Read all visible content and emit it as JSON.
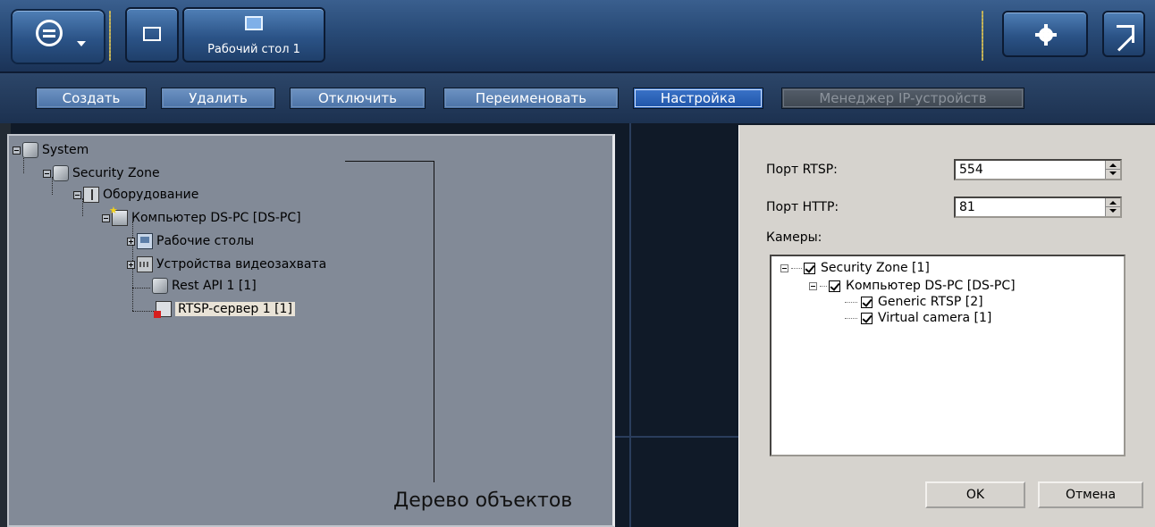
{
  "topbar": {
    "desktop_tab_label": "Рабочий стол 1"
  },
  "actions": {
    "create": "Создать",
    "delete": "Удалить",
    "disable": "Отключить",
    "rename": "Переименовать",
    "settings": "Настройка",
    "ip_manager": "Менеджер IP-устройств"
  },
  "tree": {
    "system": "System",
    "security_zone": "Security Zone",
    "equipment": "Оборудование",
    "computer": "Компьютер DS-PC [DS-PC]",
    "desktops": "Рабочие столы",
    "capture_devices": "Устройства видеозахвата",
    "rest_api": "Rest API 1 [1]",
    "rtsp_server": "RTSP-сервер 1 [1]"
  },
  "callout": {
    "label": "Дерево объектов"
  },
  "settings": {
    "rtsp_port_label": "Порт RTSP:",
    "rtsp_port_value": "554",
    "http_port_label": "Порт HTTP:",
    "http_port_value": "81",
    "cameras_label": "Камеры:",
    "cameras": {
      "zone": "Security Zone [1]",
      "computer": "Компьютер DS-PC [DS-PC]",
      "cam1": "Generic RTSP [2]",
      "cam2": "Virtual camera [1]"
    },
    "ok": "OK",
    "cancel": "Отмена"
  },
  "colors": {
    "topbar": "#284a76",
    "tree_bg": "#828a97",
    "dialog_bg": "#d6d3ce"
  }
}
